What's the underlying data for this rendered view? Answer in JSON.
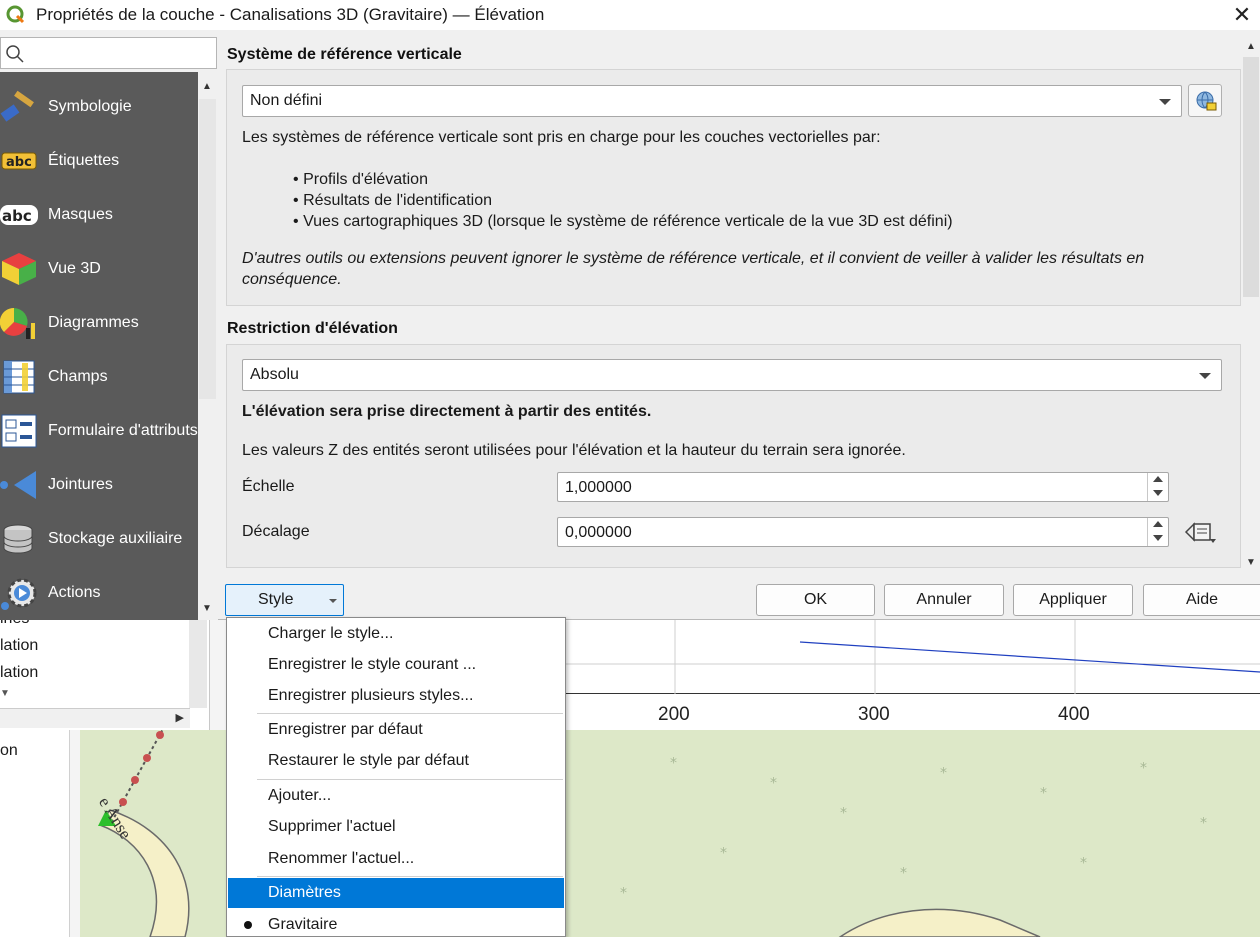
{
  "window": {
    "title": "Propriétés de la couche - Canalisations 3D (Gravitaire) — Élévation",
    "close_glyph": "✕"
  },
  "sidebar": {
    "search_placeholder": "",
    "items": [
      {
        "label": "Symbologie",
        "icon": "symbology-brush-icon"
      },
      {
        "label": "Étiquettes",
        "icon": "labels-abc-icon"
      },
      {
        "label": "Masques",
        "icon": "masks-abc-icon"
      },
      {
        "label": "Vue 3D",
        "icon": "cube-3d-icon"
      },
      {
        "label": "Diagrammes",
        "icon": "diagram-icon"
      },
      {
        "label": "Champs",
        "icon": "fields-table-icon"
      },
      {
        "label": "Formulaire d'attributs",
        "icon": "attribute-form-icon"
      },
      {
        "label": "Jointures",
        "icon": "joins-icon"
      },
      {
        "label": "Stockage auxiliaire",
        "icon": "auxiliary-storage-icon"
      },
      {
        "label": "Actions",
        "icon": "actions-gear-icon"
      }
    ]
  },
  "vertical_ref": {
    "heading": "Système de référence verticale",
    "combo_value": "Non défini",
    "intro": "Les systèmes de référence verticale sont pris en charge pour les couches vectorielles par:",
    "bullets": [
      "Profils d'élévation",
      "Résultats de l'identification",
      "Vues cartographiques 3D (lorsque le système de référence verticale de la vue 3D est défini)"
    ],
    "bullet_glyph": "•",
    "note": "D'autres outils ou extensions peuvent ignorer le système de référence verticale, et il convient de veiller à valider les résultats en conséquence."
  },
  "clamping": {
    "heading": "Restriction d'élévation",
    "combo_value": "Absolu",
    "bold_desc": "L'élévation sera prise directement à partir des entités.",
    "desc": "Les valeurs Z des entités seront utilisées pour l'élévation et la hauteur du terrain sera ignorée.",
    "scale_label": "Échelle",
    "scale_value": "1,000000",
    "offset_label": "Décalage",
    "offset_value": "0,000000"
  },
  "buttons": {
    "style": "Style",
    "ok": "OK",
    "cancel": "Annuler",
    "apply": "Appliquer",
    "help": "Aide"
  },
  "style_menu": {
    "items": [
      "Charger le style...",
      "Enregistrer le style courant ...",
      "Enregistrer plusieurs styles...",
      "Enregistrer par défaut",
      "Restaurer le style par défaut",
      "Ajouter...",
      "Supprimer l'actuel",
      "Renommer l'actuel...",
      "Diamètres",
      "Gravitaire"
    ],
    "selected": "Diamètres",
    "current": "Gravitaire"
  },
  "background": {
    "list_fragments": [
      "ines",
      "lation",
      "lation"
    ],
    "panel_fragment": "on",
    "axis_ticks": [
      "200",
      "300",
      "400"
    ],
    "map_label": "Anse",
    "map_label_prefix": "e"
  },
  "colors": {
    "accent": "#0078d7",
    "sidebar_bg": "#5a5a5a",
    "map_green": "#dde8c8",
    "profile_line": "#2040c0"
  }
}
